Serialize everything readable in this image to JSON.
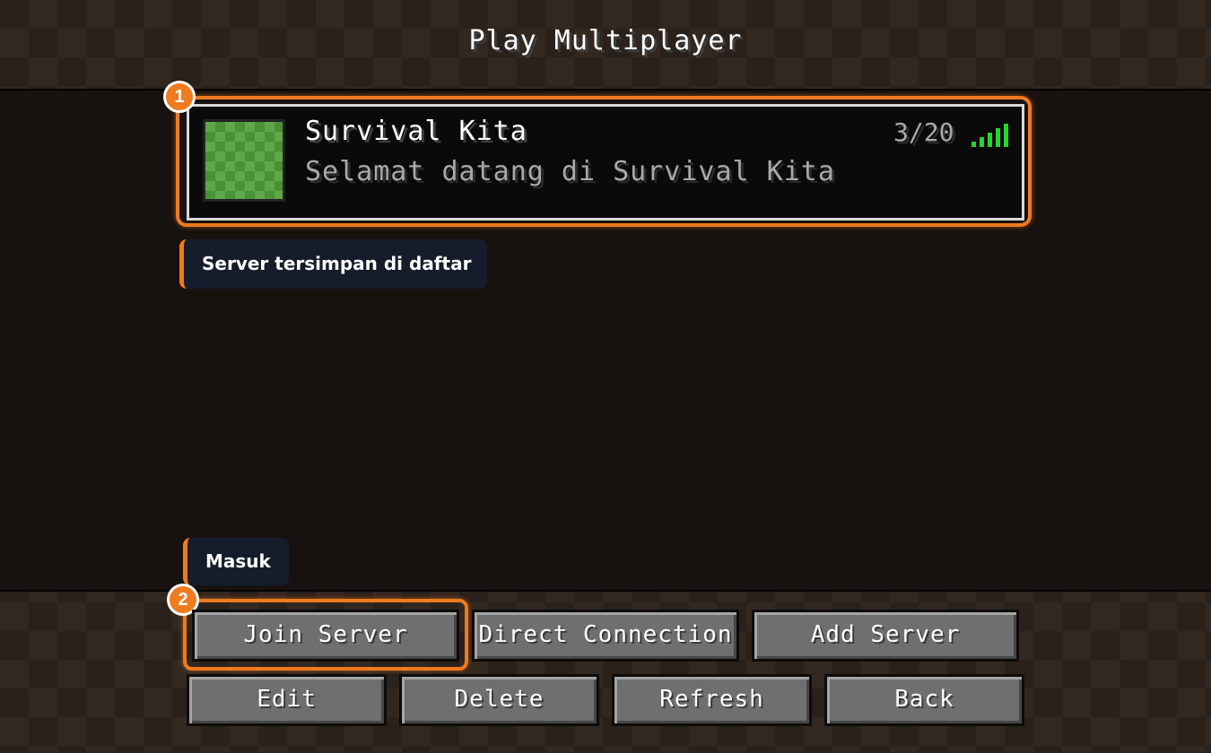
{
  "screen": {
    "title": "Play Multiplayer"
  },
  "server": {
    "name": "Survival Kita",
    "motd": "Selamat datang di Survival Kita",
    "player_count": "3/20",
    "signal_bars": 5,
    "icon": "grass-block-icon"
  },
  "annotations": [
    {
      "number": "1",
      "tooltip": "Server tersimpan di daftar"
    },
    {
      "number": "2",
      "tooltip": "Masuk"
    }
  ],
  "buttons": {
    "row1": [
      "Join Server",
      "Direct Connection",
      "Add Server"
    ],
    "row2": [
      "Edit",
      "Delete",
      "Refresh",
      "Back"
    ]
  },
  "colors": {
    "highlight": "#f07a1e",
    "signal": "#25d52c",
    "tooltip_bg": "#151d2c"
  }
}
